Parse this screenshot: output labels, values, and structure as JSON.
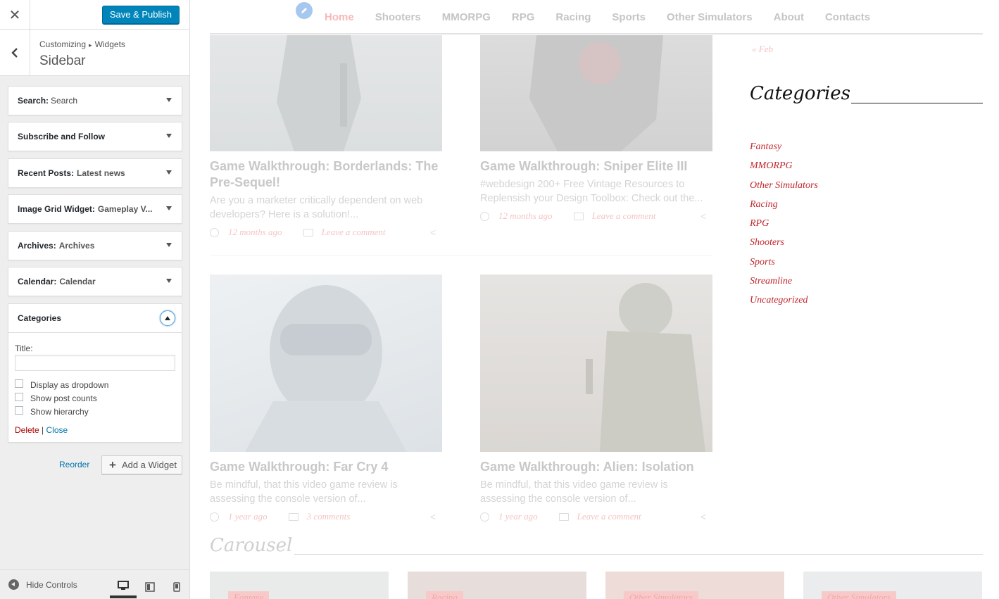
{
  "panel": {
    "save_label": "Save & Publish",
    "breadcrumb_root": "Customizing",
    "breadcrumb_sep": "▸",
    "breadcrumb_child": "Widgets",
    "section_title": "Sidebar",
    "widgets": [
      {
        "type": "Search:",
        "name": "Search"
      },
      {
        "type": "Subscribe and Follow",
        "name": ""
      },
      {
        "type": "Recent Posts:",
        "name": "Latest news"
      },
      {
        "type": "Image Grid Widget:",
        "name": "Gameplay V..."
      },
      {
        "type": "Archives:",
        "name": "Archives"
      },
      {
        "type": "Calendar:",
        "name": "Calendar"
      }
    ],
    "open_widget": {
      "type": "Categories",
      "title_label": "Title:",
      "title_value": "",
      "options": [
        "Display as dropdown",
        "Show post counts",
        "Show hierarchy"
      ],
      "delete_label": "Delete",
      "separator": "|",
      "close_label": "Close"
    },
    "reorder_label": "Reorder",
    "add_widget_label": "Add a Widget",
    "hide_controls_label": "Hide Controls",
    "accent_color": "#0085ba"
  },
  "preview": {
    "nav": [
      "Home",
      "Shooters",
      "MMORPG",
      "RPG",
      "Racing",
      "Sports",
      "Other Simulators",
      "About",
      "Contacts"
    ],
    "posts": [
      {
        "title": "Game Walkthrough: Borderlands: The Pre-Sequel!",
        "excerpt": "Are you a marketer critically dependent on web developers? Here is a solution!...",
        "date": "12 months ago",
        "comments": "Leave a comment"
      },
      {
        "title": "Game Walkthrough: Sniper Elite III",
        "excerpt": "#webdesign 200+ Free Vintage Resources to Replensish your Design Toolbox: Check out the...",
        "date": "12 months ago",
        "comments": "Leave a comment"
      },
      {
        "title": "Game Walkthrough: Far Cry 4",
        "excerpt": "Be mindful, that this video game review is assessing the console version of...",
        "date": "1 year ago",
        "comments": "3 comments"
      },
      {
        "title": "Game Walkthrough: Alien: Isolation",
        "excerpt": "Be mindful, that this video game review is assessing the console version of...",
        "date": "1 year ago",
        "comments": "Leave a comment"
      }
    ],
    "calendar_prev": "« Feb",
    "categories_heading": "Categories",
    "categories": [
      "Fantasy",
      "MMORPG",
      "Other Simulators",
      "Racing",
      "RPG",
      "Shooters",
      "Sports",
      "Streamline",
      "Uncategorized"
    ],
    "carousel_heading": "Carousel",
    "carousel_tags": [
      "Fantasy",
      "Racing",
      "Other Simulators",
      "Other Simulators"
    ],
    "link_color": "#c1272d"
  }
}
